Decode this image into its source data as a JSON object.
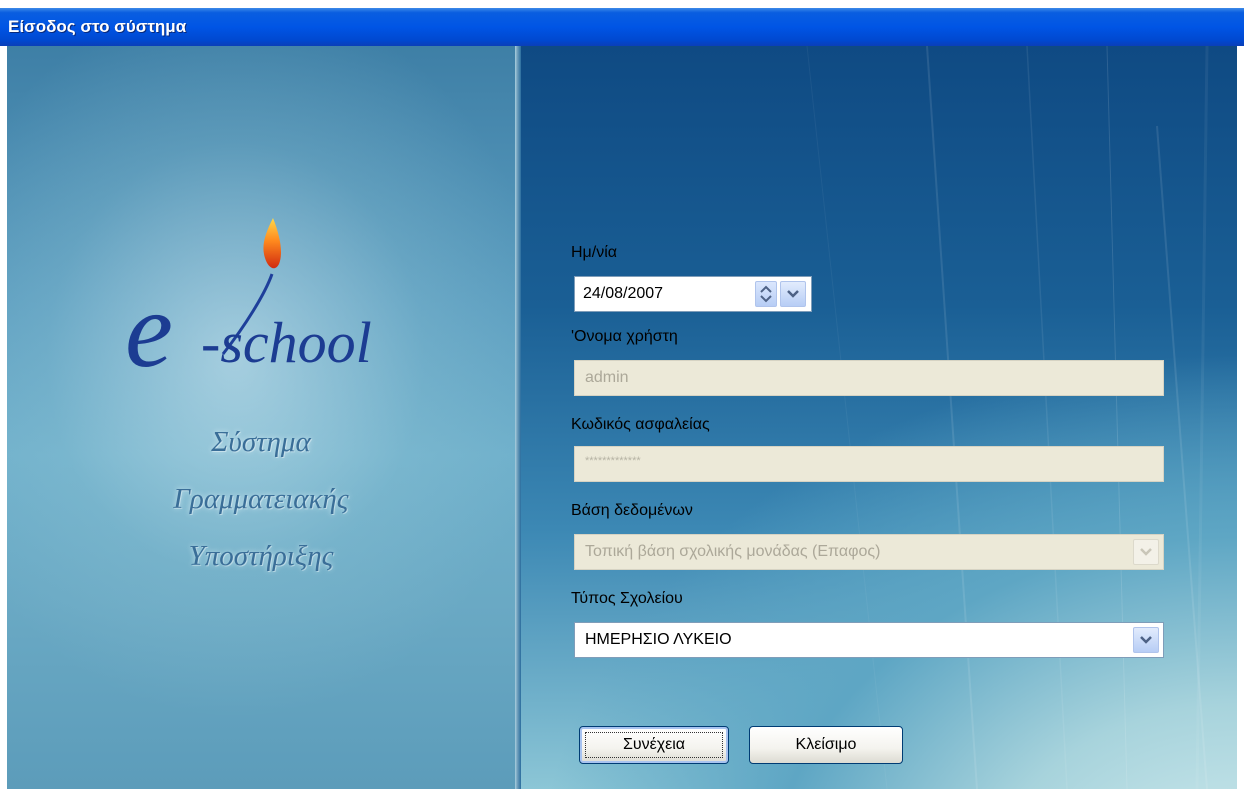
{
  "window": {
    "title": "Είσοδος στο σύστημα"
  },
  "branding": {
    "logo_text": "-school",
    "subtitle_lines": [
      "Σύστημα",
      "Γραμματειακής",
      "Υποστήριξης"
    ]
  },
  "form": {
    "date": {
      "label": "Ημ/νία",
      "value": "24/08/2007"
    },
    "username": {
      "label": "'Ονομα χρήστη",
      "value": "admin",
      "enabled": false
    },
    "password": {
      "label": "Κωδικός ασφαλείας",
      "value": "*************",
      "enabled": false
    },
    "database": {
      "label": "Βάση δεδομένων",
      "selected": "Τοπική βάση σχολικής μονάδας (Επαφος)",
      "enabled": false
    },
    "school_type": {
      "label": "Τύπος Σχολείου",
      "selected": "ΗΜΕΡΗΣΙΟ ΛΥΚΕΙΟ"
    }
  },
  "buttons": {
    "continue_label": "Συνέχεια",
    "close_label": "Κλείσιμο"
  },
  "icons": {
    "spin": "spin-updown-icon",
    "dropdown": "chevron-down-icon",
    "flame": "flame-icon"
  },
  "colors": {
    "titlebar": "#0055e5",
    "disabled_field": "#ece9d8",
    "button_border": "#003c74"
  }
}
